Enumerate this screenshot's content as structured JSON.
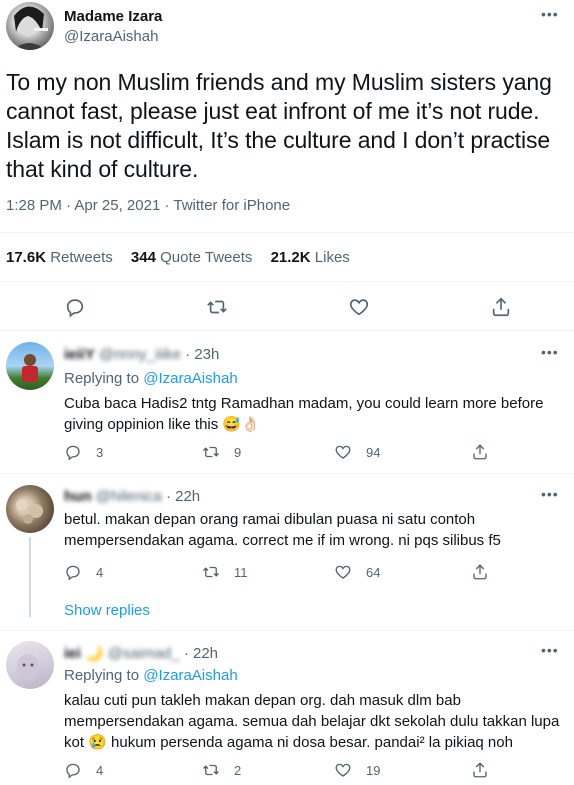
{
  "tweet": {
    "display_name": "Madame Izara",
    "handle": "@IzaraAishah",
    "text": "To my non Muslim friends and my Muslim sisters yang cannot fast, please just eat infront of me it’s not rude. Islam is not difficult, It’s the culture and I don’t practise that kind of culture.",
    "time": "1:28 PM",
    "date": "Apr 25, 2021",
    "client": "Twitter for iPhone",
    "stats": {
      "retweets_value": "17.6K",
      "retweets_label": "Retweets",
      "quotes_value": "344",
      "quotes_label": "Quote Tweets",
      "likes_value": "21.2K",
      "likes_label": "Likes"
    }
  },
  "replies": [
    {
      "name": "ieiiY",
      "handle": "@nnny_iiike",
      "age": "23h",
      "replying_prefix": "Replying to",
      "replying_to": "@IzaraAishah",
      "text_line1": "Cuba baca Hadis2 tntg Ramadhan madam, you could learn more before",
      "text_line2": "giving oppinion like this 😅👌🏻",
      "replies": "3",
      "retweets": "9",
      "likes": "94"
    },
    {
      "name": "hun",
      "handle": "@hilenica",
      "age": "22h",
      "text_line1": "betul. makan depan orang ramai dibulan puasa ni satu contoh",
      "text_line2": "mempersendakan agama. correct me if im wrong. ni pqs silibus f5",
      "replies": "4",
      "retweets": "11",
      "likes": "64",
      "show_replies": "Show replies"
    },
    {
      "name": "iei 🌙",
      "handle": "@saimad_",
      "age": "22h",
      "replying_prefix": "Replying to",
      "replying_to": "@IzaraAishah",
      "text_line1": "kalau cuti pun takleh makan depan org. dah masuk dlm bab",
      "text_line2": "mempersendakan agama. semua dah belajar dkt sekolah dulu takkan lupa",
      "text_line3": "kot 😢 hukum persenda agama ni dosa besar. pandai² la pikiaq noh",
      "replies": "4",
      "retweets": "2",
      "likes": "19"
    }
  ],
  "more_symbol": "•••",
  "dot_sep": "·"
}
